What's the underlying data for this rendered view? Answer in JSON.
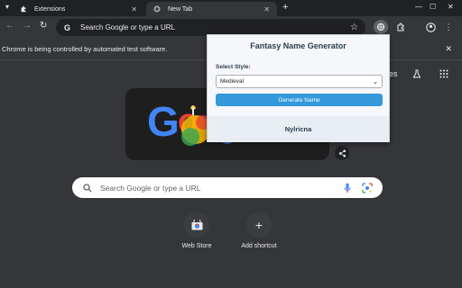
{
  "tabs": [
    {
      "label": "Extensions",
      "icon": "puzzle-icon",
      "active": false
    },
    {
      "label": "New Tab",
      "icon": "chrome-icon",
      "active": true
    }
  ],
  "toolbar": {
    "omnibox_text": "Search Google or type a URL"
  },
  "infobar": {
    "text": "Chrome is being controlled by automated test software."
  },
  "ntp": {
    "top_right_fragment": "es",
    "search_placeholder": "Search Google or type a URL",
    "doodle_letters": [
      "G",
      "o"
    ],
    "shortcuts": [
      {
        "label": "Web Store",
        "icon": "webstore-icon"
      },
      {
        "label": "Add shortcut",
        "icon": "plus-icon"
      }
    ]
  },
  "popup": {
    "title": "Fantasy Name Generator",
    "select_label": "Select Style:",
    "select_value": "Medieval",
    "button_label": "Generate Name",
    "result": "Nylricna"
  },
  "colors": {
    "window_bg": "#202124",
    "page_bg": "#35363a",
    "popup_button": "#3498db",
    "popup_bg": "#f5f7fa"
  }
}
